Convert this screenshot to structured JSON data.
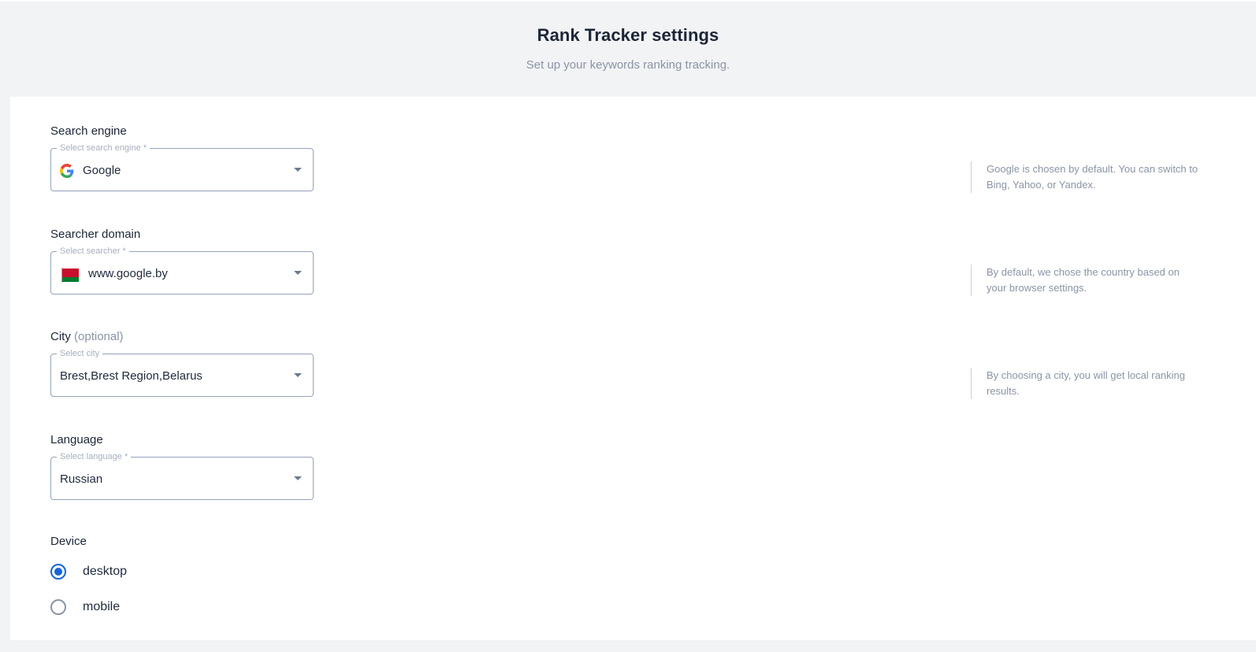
{
  "header": {
    "title": "Rank Tracker settings",
    "subtitle": "Set up your keywords ranking tracking."
  },
  "search_engine": {
    "label": "Search engine",
    "field_label": "Select search engine *",
    "value": "Google",
    "icon": "google-icon",
    "hint": "Google is chosen by default. You can switch to Bing, Yahoo, or Yandex."
  },
  "searcher_domain": {
    "label": "Searcher domain",
    "field_label": "Select searcher *",
    "value": "www.google.by",
    "icon": "belarus-flag-icon",
    "hint": "By default, we chose the country based on your browser settings."
  },
  "city": {
    "label": "City",
    "optional": "(optional)",
    "field_label": "Select city",
    "value": "Brest,Brest Region,Belarus",
    "hint": "By choosing a city, you will get local ranking results."
  },
  "language": {
    "label": "Language",
    "field_label": "Select language *",
    "value": "Russian"
  },
  "device": {
    "label": "Device",
    "options": [
      {
        "label": "desktop",
        "selected": true
      },
      {
        "label": "mobile",
        "selected": false
      }
    ]
  },
  "colors": {
    "accent": "#1565d8",
    "background": "#f2f3f5",
    "text": "#1b2637",
    "muted": "#8a94a6"
  }
}
